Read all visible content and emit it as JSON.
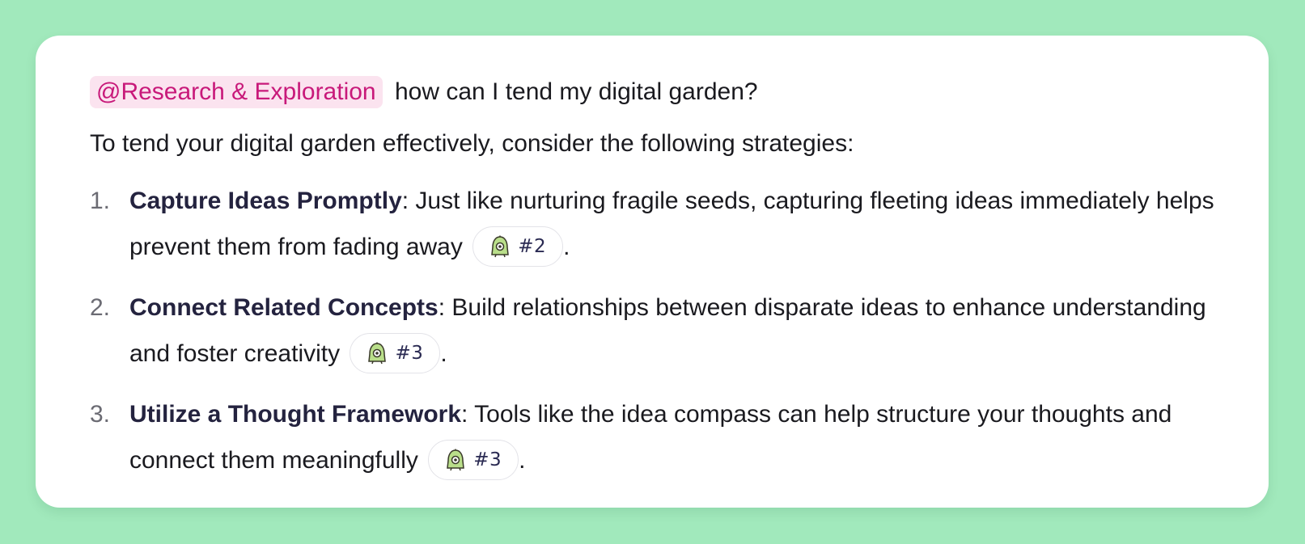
{
  "message": {
    "mention": "@Research & Exploration",
    "question": " how can I tend my digital garden?"
  },
  "answer": {
    "intro": "To tend your digital garden effectively, consider the following strategies:",
    "items": [
      {
        "number": "1.",
        "title": "Capture Ideas Promptly",
        "text": ": Just like nurturing fragile seeds, capturing fleeting ideas immediately helps prevent them from fading away",
        "citation": "#2",
        "end": "."
      },
      {
        "number": "2.",
        "title": "Connect Related Concepts",
        "text": ": Build relationships between disparate ideas to enhance understanding and foster creativity",
        "citation": "#3",
        "end": "."
      },
      {
        "number": "3.",
        "title": "Utilize a Thought Framework",
        "text": ": Tools like the idea compass can help structure your thoughts and connect them meaningfully",
        "citation": "#3",
        "end": "."
      }
    ]
  },
  "icons": {
    "citation": "source-character-icon"
  },
  "colors": {
    "background": "#a1e9bc",
    "mention_text": "#c8197a",
    "mention_bg": "#fbe3ef",
    "title_text": "#24233f"
  }
}
